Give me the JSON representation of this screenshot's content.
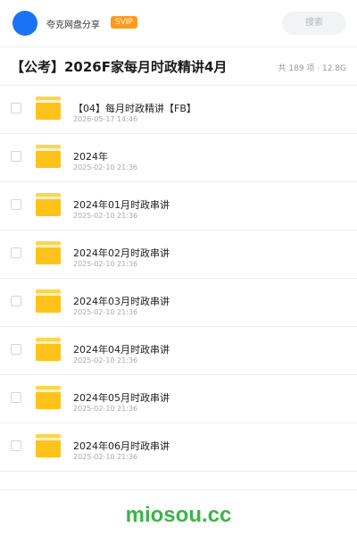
{
  "header": {
    "user_name": "夸克网盘分享",
    "badge": "SVIP",
    "search_placeholder": "搜索"
  },
  "share": {
    "title": "【公考】2026F家每月时政精讲4月",
    "meta": "共 189 项 · 12.8G"
  },
  "files": [
    {
      "name": "【04】每月时政精讲【FB】",
      "date": "2026-05-17 14:46"
    },
    {
      "name": "2024年",
      "date": "2025-02-10 21:36"
    },
    {
      "name": "2024年01月时政串讲",
      "date": "2025-02-10 21:36"
    },
    {
      "name": "2024年02月时政串讲",
      "date": "2025-02-10 21:36"
    },
    {
      "name": "2024年03月时政串讲",
      "date": "2025-02-10 21:36"
    },
    {
      "name": "2024年04月时政串讲",
      "date": "2025-02-10 21:36"
    },
    {
      "name": "2024年05月时政串讲",
      "date": "2025-02-10 21:36"
    },
    {
      "name": "2024年06月时政串讲",
      "date": "2025-02-10 21:36"
    }
  ],
  "watermark": "miosou.cc",
  "colors": {
    "avatar": "#1a73f5",
    "badge": "#ff9a1a",
    "folder": "#ffc21a",
    "watermark": "#3ab54a"
  }
}
